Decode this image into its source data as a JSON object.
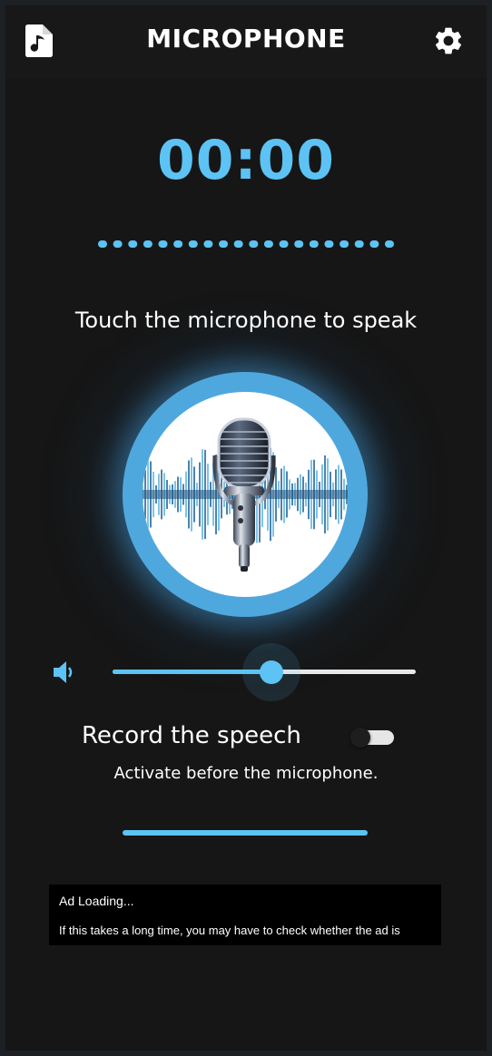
{
  "header": {
    "title": "MICROPHONE",
    "left_icon": "music-file-icon",
    "right_icon": "gear-icon"
  },
  "timer": {
    "value": "00:00"
  },
  "level_indicator": {
    "dot_count": 20
  },
  "prompt": {
    "text": "Touch the microphone to speak"
  },
  "microphone": {
    "icon": "microphone-icon"
  },
  "volume": {
    "icon": "speaker-icon",
    "level_fraction": 0.5
  },
  "record": {
    "label": "Record the speech",
    "enabled": false,
    "hint": "Activate before the microphone."
  },
  "ad": {
    "title": "Ad Loading...",
    "message": "If this takes a long time, you may have to check whether the ad is"
  },
  "colors": {
    "accent": "#5cc3f4",
    "background": "#161616",
    "topbar": "#181818",
    "text": "#ffffff"
  }
}
